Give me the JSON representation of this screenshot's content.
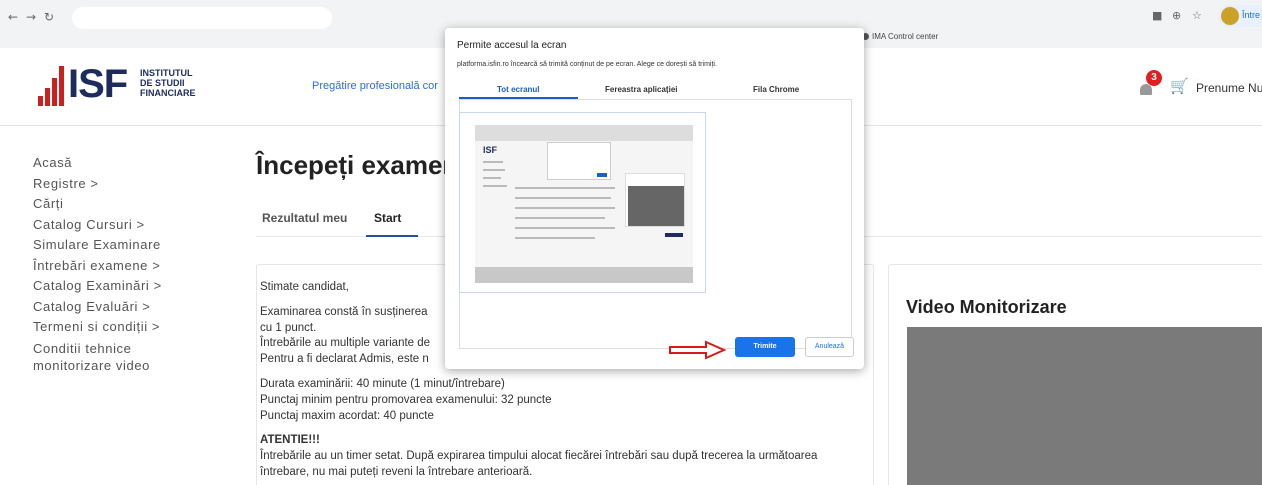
{
  "browser": {
    "back_icon": "back-arrow-icon",
    "forward_icon": "forward-arrow-icon",
    "reload_icon": "reload-icon",
    "bookmark": "IMA Control center",
    "profile_label": "Între"
  },
  "header": {
    "logo_letters": "ISF",
    "logo_text_1": "INSTITUTUL",
    "logo_text_2": "DE STUDII",
    "logo_text_3": "FINANCIARE",
    "nav_link": "Pregătire profesională cor",
    "notification_count": "3",
    "user_name": "Prenume Num",
    "colors": {
      "brand_red": "#cc1f1f",
      "brand_navy": "#1d2b5e",
      "link": "#2a6fdb"
    }
  },
  "sidebar": {
    "items": [
      "Acasă",
      "Registre  >",
      "Cărți",
      "Catalog Cursuri  >",
      "Simulare Examinare",
      "Întrebări examene  >",
      "Catalog Examinări  >",
      "Catalog Evaluări  >",
      "Termeni si condiții  >",
      "Conditii tehnice monitorizare video"
    ]
  },
  "main": {
    "title": "Începeți examenu",
    "tabs": [
      "Rezultatul meu",
      "Start"
    ],
    "active_tab": "Start",
    "info": {
      "greeting": "Stimate candidat,",
      "line1": "Examinarea constă în susținerea",
      "line2": "cu 1 punct.",
      "line3": "Întrebările au multiple variante de",
      "line4": "Pentru a fi declarat Admis, este n",
      "duration": "Durata examinării: 40 minute (1 minut/întrebare)",
      "min_score": "Punctaj minim pentru promovarea examenului: 32 puncte",
      "max_score": "Punctaj maxim acordat: 40 puncte",
      "warning_head": "ATENTIE!!!",
      "warning_1": "Întrebările au un timer setat. După expirarea timpului alocat fiecărei întrebări sau după trecerea la următoarea",
      "warning_2": "întrebare, nu mai puteți reveni la întrebare anterioară."
    },
    "video_title": "Video Monitorizare"
  },
  "dialog": {
    "title": "Permite accesul la ecran",
    "subtitle": "platforma.isfin.ro încearcă să trimită conținut de pe ecran. Alege ce dorești să trimiți.",
    "tabs": [
      "Tot ecranul",
      "Fereastra aplicației",
      "Fila Chrome"
    ],
    "active_tab": "Tot ecranul",
    "thumb_logo": "ISF",
    "share_button": "Trimite",
    "cancel_button": "Anulează"
  }
}
